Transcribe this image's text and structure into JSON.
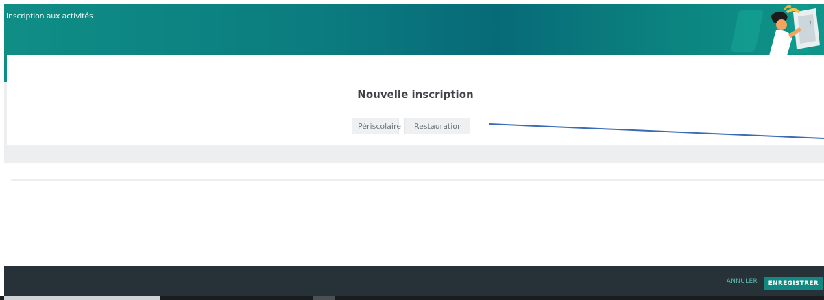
{
  "header": {
    "title": "Inscription aux activités",
    "illustration_icon": "person-with-tablet-illustration"
  },
  "card": {
    "title": "Nouvelle inscription",
    "tabs": [
      {
        "label": "Périscolaire"
      },
      {
        "label": "Restauration"
      }
    ]
  },
  "footer": {
    "cancel_label": "ANNULER",
    "save_label": "ENREGISTRER"
  },
  "colors": {
    "brand_teal": "#0f8e86",
    "footer_bg": "#263238",
    "annotation_line": "#3b6bb5",
    "annotation_arrow": "#e03030"
  }
}
